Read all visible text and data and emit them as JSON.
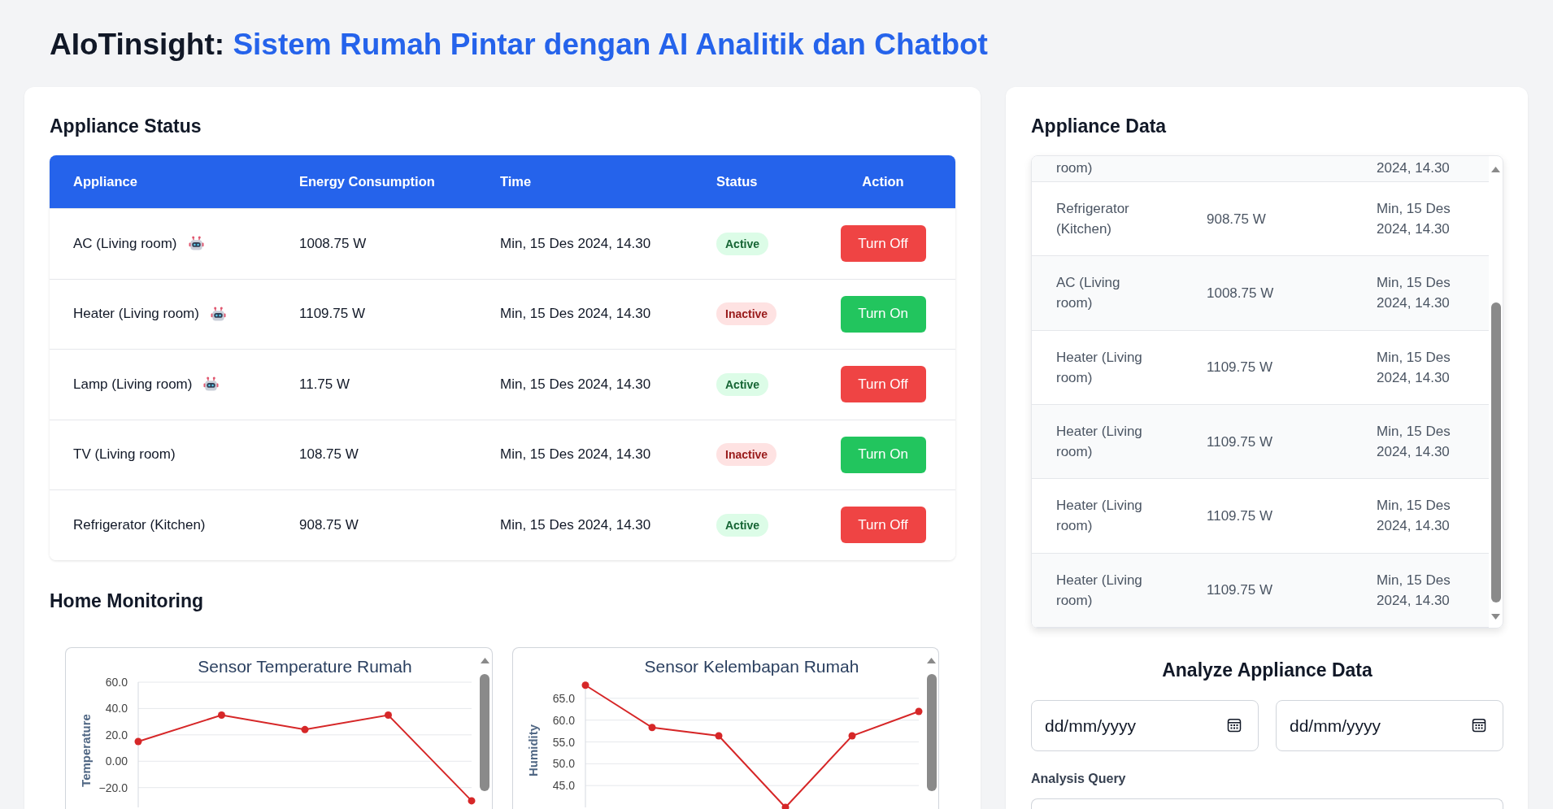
{
  "header": {
    "brand": "AIoTinsight:",
    "title": "Sistem Rumah Pintar dengan AI Analitik dan Chatbot"
  },
  "appliance_status": {
    "heading": "Appliance Status",
    "columns": [
      "Appliance",
      "Energy Consumption",
      "Time",
      "Status",
      "Action"
    ],
    "rows": [
      {
        "appliance": "AC (Living room)",
        "ai_icon": true,
        "energy": "1008.75 W",
        "time": "Min, 15 Des 2024, 14.30",
        "status": "Active",
        "active": true,
        "action": "Turn Off"
      },
      {
        "appliance": "Heater (Living room)",
        "ai_icon": true,
        "energy": "1109.75 W",
        "time": "Min, 15 Des 2024, 14.30",
        "status": "Inactive",
        "active": false,
        "action": "Turn On"
      },
      {
        "appliance": "Lamp (Living room)",
        "ai_icon": true,
        "energy": "11.75 W",
        "time": "Min, 15 Des 2024, 14.30",
        "status": "Active",
        "active": true,
        "action": "Turn Off"
      },
      {
        "appliance": "TV (Living room)",
        "ai_icon": false,
        "energy": "108.75 W",
        "time": "Min, 15 Des 2024, 14.30",
        "status": "Inactive",
        "active": false,
        "action": "Turn On"
      },
      {
        "appliance": "Refrigerator (Kitchen)",
        "ai_icon": false,
        "energy": "908.75 W",
        "time": "Min, 15 Des 2024, 14.30",
        "status": "Active",
        "active": true,
        "action": "Turn Off"
      }
    ]
  },
  "home_monitoring": {
    "heading": "Home Monitoring",
    "charts": [
      {
        "chart_data": {
          "type": "line",
          "title": "Sensor Temperature Rumah",
          "ylabel": "Temperature",
          "categories": [
            null,
            null,
            null,
            null,
            null
          ],
          "ylim": [
            -35,
            60
          ],
          "grid": true,
          "yticks": [
            {
              "value": 60,
              "label": "60.0"
            },
            {
              "value": 40,
              "label": "40.0"
            },
            {
              "value": 20,
              "label": "20.0"
            },
            {
              "value": 0,
              "label": "0.00"
            },
            {
              "value": -20,
              "label": "−20.0"
            }
          ],
          "series": [
            {
              "color": "#d62728",
              "marker": true,
              "values": [
                15,
                35,
                24,
                35,
                -30
              ]
            }
          ]
        }
      },
      {
        "chart_data": {
          "type": "line",
          "title": "Sensor Kelembapan Rumah",
          "ylabel": "Humidity",
          "categories": [
            null,
            null,
            null,
            null,
            null,
            null
          ],
          "ylim": [
            40,
            68.7
          ],
          "grid": true,
          "yticks": [
            {
              "value": 65,
              "label": "65.0"
            },
            {
              "value": 60,
              "label": "60.0"
            },
            {
              "value": 55,
              "label": "55.0"
            },
            {
              "value": 50,
              "label": "50.0"
            },
            {
              "value": 45,
              "label": "45.0"
            }
          ],
          "series": [
            {
              "color": "#d62728",
              "marker": true,
              "values": [
                68,
                58.3,
                56.4,
                40,
                56.4,
                62
              ]
            }
          ]
        }
      }
    ]
  },
  "appliance_data": {
    "heading": "Appliance Data",
    "clipped_row": {
      "appliance": "room)",
      "time": "2024, 14.30"
    },
    "rows": [
      {
        "appliance": "Refrigerator (Kitchen)",
        "energy": "908.75 W",
        "time": "Min, 15 Des 2024, 14.30"
      },
      {
        "appliance": "AC (Living room)",
        "energy": "1008.75 W",
        "time": "Min, 15 Des 2024, 14.30"
      },
      {
        "appliance": "Heater (Living room)",
        "energy": "1109.75 W",
        "time": "Min, 15 Des 2024, 14.30"
      },
      {
        "appliance": "Heater (Living room)",
        "energy": "1109.75 W",
        "time": "Min, 15 Des 2024, 14.30"
      },
      {
        "appliance": "Heater (Living room)",
        "energy": "1109.75 W",
        "time": "Min, 15 Des 2024, 14.30"
      },
      {
        "appliance": "Heater (Living room)",
        "energy": "1109.75 W",
        "time": "Min, 15 Des 2024, 14.30"
      }
    ]
  },
  "analyze": {
    "heading": "Analyze Appliance Data",
    "date_fields": [
      {
        "placeholder": "dd/mm/yyyy"
      },
      {
        "placeholder": "dd/mm/yyyy"
      }
    ],
    "query_label": "Analysis Query"
  }
}
